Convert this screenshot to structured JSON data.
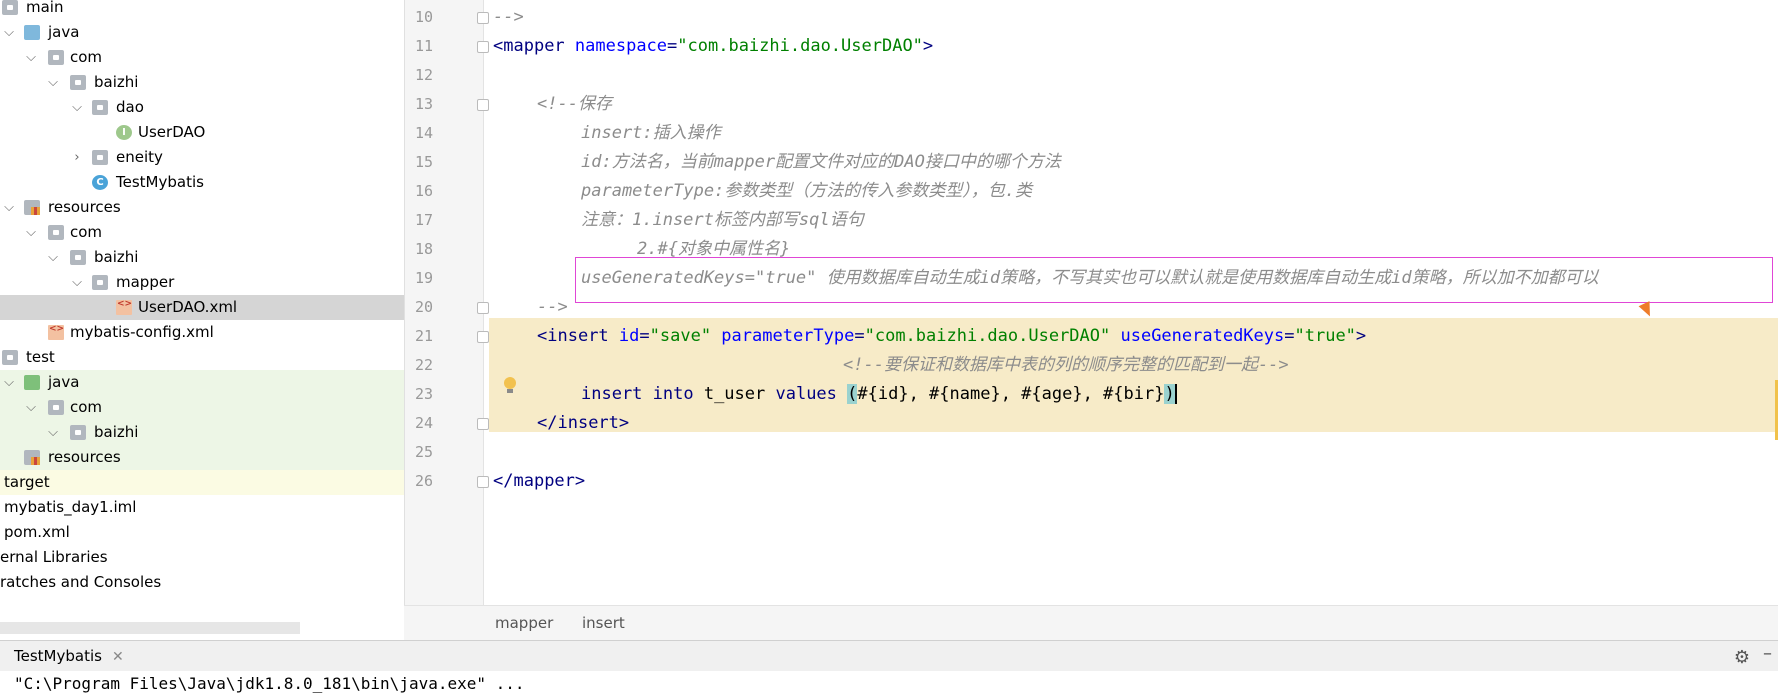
{
  "project_tree": {
    "items": [
      {
        "label": "main",
        "icon": "folder-icon"
      },
      {
        "label": "java",
        "icon": "source-folder-icon"
      },
      {
        "label": "com",
        "icon": "package-icon"
      },
      {
        "label": "baizhi",
        "icon": "package-icon"
      },
      {
        "label": "dao",
        "icon": "package-icon"
      },
      {
        "label": "UserDAO",
        "icon": "interface-icon"
      },
      {
        "label": "eneity",
        "icon": "package-icon"
      },
      {
        "label": "TestMybatis",
        "icon": "class-icon"
      },
      {
        "label": "resources",
        "icon": "resources-folder-icon"
      },
      {
        "label": "com",
        "icon": "folder-icon"
      },
      {
        "label": "baizhi",
        "icon": "folder-icon"
      },
      {
        "label": "mapper",
        "icon": "folder-icon"
      },
      {
        "label": "UserDAO.xml",
        "icon": "xml-file-icon"
      },
      {
        "label": "mybatis-config.xml",
        "icon": "xml-file-icon"
      },
      {
        "label": "test",
        "icon": "folder-icon"
      },
      {
        "label": "java",
        "icon": "test-source-folder-icon"
      },
      {
        "label": "com",
        "icon": "package-icon"
      },
      {
        "label": "baizhi",
        "icon": "package-icon"
      },
      {
        "label": "resources",
        "icon": "resources-folder-icon"
      },
      {
        "label": "target",
        "icon": ""
      },
      {
        "label": "mybatis_day1.iml",
        "icon": ""
      },
      {
        "label": "pom.xml",
        "icon": ""
      },
      {
        "label": "ernal Libraries",
        "icon": ""
      },
      {
        "label": "ratches and Consoles",
        "icon": ""
      }
    ]
  },
  "editor": {
    "line_numbers": [
      "10",
      "11",
      "12",
      "13",
      "14",
      "15",
      "16",
      "17",
      "18",
      "19",
      "20",
      "21",
      "22",
      "23",
      "24",
      "25",
      "26"
    ],
    "lines": {
      "l10": "-->",
      "l11_open": "<",
      "l11_tag": "mapper",
      "l11_attr": " namespace",
      "l11_eq": "=",
      "l11_val": "\"com.baizhi.dao.UserDAO\"",
      "l11_close": ">",
      "l13": "<!--保存",
      "l14": "insert:插入操作",
      "l15": "id:方法名，当前mapper配置文件对应的DAO接口中的哪个方法",
      "l16": "parameterType:参数类型（方法的传入参数类型），包.类",
      "l17": "注意：1.insert标签内部写sql语句",
      "l18": "2.#{对象中属性名}",
      "l19": "useGeneratedKeys=\"true\" 使用数据库自动生成id策略，不写其实也可以默认就是使用数据库自动生成id策略，所以加不加都可以",
      "l20": "-->",
      "l21_tag": "insert",
      "l21_a1": " id",
      "l21_v1": "\"save\"",
      "l21_a2": " parameterType",
      "l21_v2": "\"com.baizhi.dao.UserDAO\"",
      "l21_a3": " useGeneratedKeys",
      "l21_v3": "\"true\"",
      "l22": "<!--要保证和数据库中表的列的顺序完整的匹配到一起-->",
      "l23_kw": "insert into",
      "l23_rest": " t_user ",
      "l23_kw2": "values",
      "l23_params": "#{id}, #{name}, #{age}, #{bir}",
      "l24_tag": "insert",
      "l26_tag": "mapper"
    }
  },
  "breadcrumb": {
    "items": [
      "mapper",
      "insert"
    ]
  },
  "run_panel": {
    "tab_label": "TestMybatis",
    "console_line": "\"C:\\Program Files\\Java\\jdk1.8.0_181\\bin\\java.exe\" ..."
  },
  "colors": {
    "tag": "#000080",
    "attribute": "#0000ff",
    "value": "#008000",
    "comment": "#8c8c8c",
    "highlight_box": "#e046d6",
    "current_block": "#f7ebc8"
  }
}
